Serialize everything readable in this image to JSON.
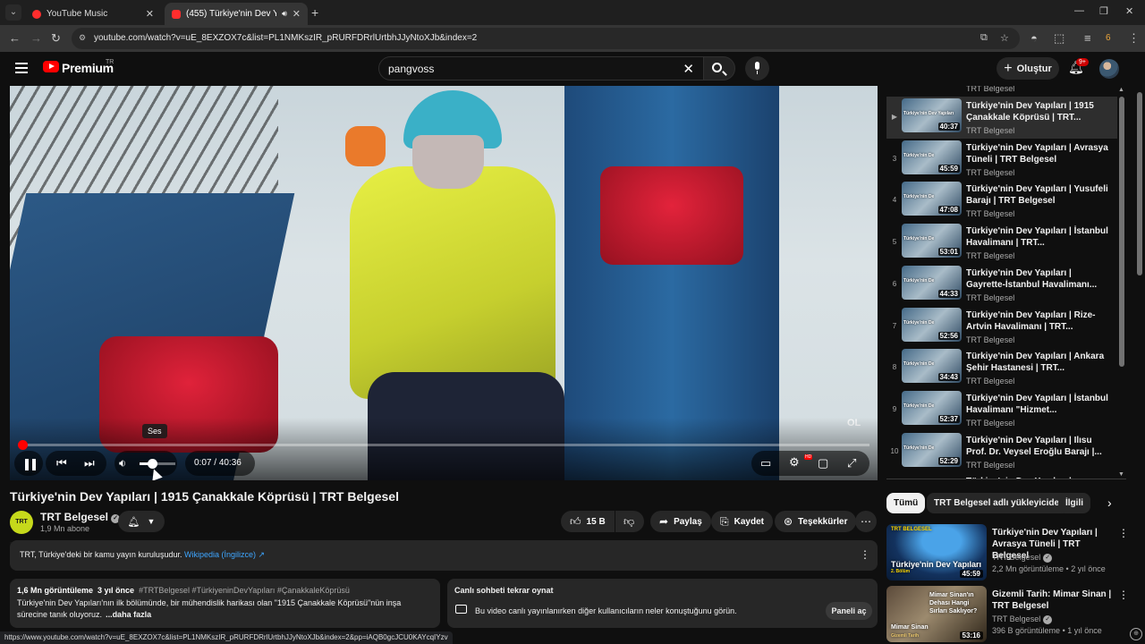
{
  "browser": {
    "tabs": [
      {
        "title": "YouTube Music",
        "active": false
      },
      {
        "title": "(455) Türkiye'nin Dev Yapıla",
        "active": true
      }
    ],
    "url": "youtube.com/watch?v=uE_8EXZOX7c&list=PL1NMKszIR_pRURFDRrlUrtbhJJyNtoXJb&index=2",
    "status_url": "https://www.youtube.com/watch?v=uE_8EXZOX7c&list=PL1NMKszIR_pRURFDRrlUrtbhJJyNtoXJb&index=2&pp=iAQB0gcJCU0KAYcqIYzv",
    "profile_badge": "6"
  },
  "header": {
    "logo_text": "Premium",
    "region": "TR",
    "search_value": "pangvoss",
    "create_label": "Oluştur",
    "notifications_badge": "9+"
  },
  "player": {
    "current_time": "0:07",
    "duration": "40:36",
    "progress_fraction": 0.003,
    "volume_fraction": 0.35,
    "tooltip": "Ses",
    "watermark": "OL",
    "time_separator": "/"
  },
  "video": {
    "title": "Türkiye'nin Dev Yapıları | 1915 Çanakkale Köprüsü | TRT Belgesel",
    "channel": "TRT Belgesel",
    "channel_avatar_text": "TRT Belgesel",
    "subscribers": "1,9 Mn abone",
    "likes": "15 B",
    "share_label": "Paylaş",
    "save_label": "Kaydet",
    "thanks_label": "Teşekkürler"
  },
  "infobar": {
    "text": "TRT, Türkiye'deki bir kamu yayın kuruluşudur.",
    "link": "Wikipedia (İngilizce)",
    "link_icon": "↗"
  },
  "description": {
    "views": "1,6 Mn görüntüleme",
    "age": "3 yıl önce",
    "tags": "#TRTBelgesel #TürkiyeninDevYapıları #ÇanakkaleKöprüsü",
    "body": "Türkiye'nin Dev Yapıları'nın ilk bölümünde, bir mühendislik harikası olan \"1915 Çanakkale Köprüsü\"nün inşa sürecine tanık oluyoruz.",
    "more": "...daha fazla"
  },
  "chat": {
    "title": "Canlı sohbeti tekrar oynat",
    "text": "Bu video canlı yayınlanırken diğer kullanıcıların neler konuştuğunu görün.",
    "button": "Paneli aç"
  },
  "playlist": {
    "top_partial_channel": "TRT Belgesel",
    "items": [
      {
        "index": "▶",
        "title": "Türkiye'nin Dev Yapıları | 1915 Çanakkale Köprüsü | TRT...",
        "channel": "TRT Belgesel",
        "duration": "40:37",
        "thumb_label": "Türkiye'nin Dev Yapıları",
        "active": true
      },
      {
        "index": "3",
        "title": "Türkiye'nin Dev Yapıları | Avrasya Tüneli | TRT Belgesel",
        "channel": "TRT Belgesel",
        "duration": "45:59",
        "thumb_label": "Türkiye'nin De",
        "active": false
      },
      {
        "index": "4",
        "title": "Türkiye'nin Dev Yapıları | Yusufeli Barajı | TRT Belgesel",
        "channel": "TRT Belgesel",
        "duration": "47:08",
        "thumb_label": "Türkiye'nin De",
        "active": false
      },
      {
        "index": "5",
        "title": "Türkiye'nin Dev Yapıları | İstanbul Havalimanı | TRT...",
        "channel": "TRT Belgesel",
        "duration": "53:01",
        "thumb_label": "Türkiye'nin De",
        "active": false
      },
      {
        "index": "6",
        "title": "Türkiye'nin Dev Yapıları | Gayrette-İstanbul Havalimanı...",
        "channel": "TRT Belgesel",
        "duration": "44:33",
        "thumb_label": "Türkiye'nin De",
        "active": false
      },
      {
        "index": "7",
        "title": "Türkiye'nin Dev Yapıları | Rize-Artvin Havalimanı | TRT...",
        "channel": "TRT Belgesel",
        "duration": "52:56",
        "thumb_label": "Türkiye'nin De",
        "active": false
      },
      {
        "index": "8",
        "title": "Türkiye'nin Dev Yapıları | Ankara Şehir Hastanesi | TRT...",
        "channel": "TRT Belgesel",
        "duration": "34:43",
        "thumb_label": "Türkiye'nin De",
        "active": false
      },
      {
        "index": "9",
        "title": "Türkiye'nin Dev Yapıları | İstanbul Havalimanı \"Hizmet...",
        "channel": "TRT Belgesel",
        "duration": "52:37",
        "thumb_label": "Türkiye'nin De",
        "active": false
      },
      {
        "index": "10",
        "title": "Türkiye'nin Dev Yapıları | Ilısu Prof. Dr. Veysel Eroğlu Barajı |...",
        "channel": "TRT Belgesel",
        "duration": "52:29",
        "thumb_label": "Türkiye'nin De",
        "active": false
      }
    ],
    "bottom_partial_title": "Türkiye'nin Dev Yapıları |"
  },
  "chips": [
    "Tümü",
    "TRT Belgesel adlı yükleyiciden",
    "İlgili"
  ],
  "related": [
    {
      "title": "Türkiye'nin Dev Yapıları | Avrasya Tüneli | TRT Belgesel",
      "channel": "TRT Belgesel",
      "views": "2,2 Mn görüntüleme",
      "age": "2 yıl önce",
      "duration": "45:59",
      "overlay": "Türkiye'nin Dev Yapıları",
      "overlay2": "TRT BELGESEL",
      "episode_label": "2. Bölüm"
    },
    {
      "title": "Gizemli Tarih: Mimar Sinan | TRT Belgesel",
      "channel": "TRT Belgesel",
      "views": "396 B görüntüleme",
      "age": "1 yıl önce",
      "duration": "53:16",
      "overlay": "Mimar Sinan'ın Dehası Hangi Sırları Saklıyor?",
      "overlay2": "Mimar Sinan",
      "overlay3": "Gizemli Tarih"
    }
  ],
  "colors": {
    "accent": "#ff0000",
    "link": "#3ea6ff",
    "background": "#0f0f0f"
  }
}
